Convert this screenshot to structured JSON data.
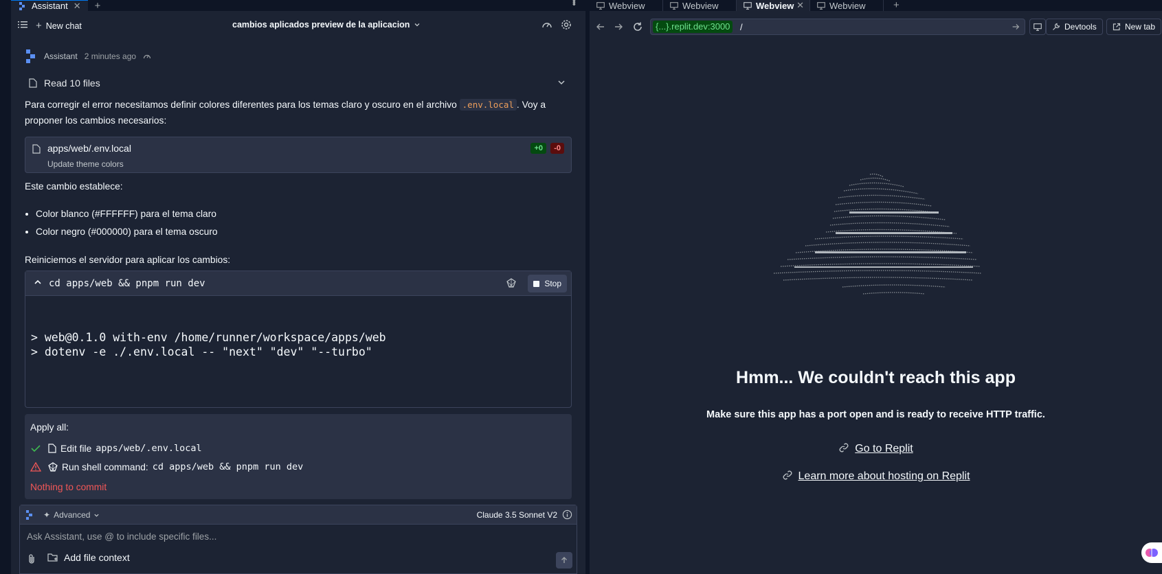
{
  "left": {
    "tab": {
      "label": "Assistant"
    },
    "header": {
      "new_chat": "New chat",
      "chat_title": "cambios aplicados preview de la aplicacion"
    },
    "message": {
      "author": "Assistant",
      "time": "2 minutes ago",
      "read_files": "Read 10 files",
      "intro_before": "Para corregir el error necesitamos definir colores diferentes para los temas claro y oscuro en el archivo ",
      "intro_code": ".env.local",
      "intro_after": ". Voy a proponer los cambios necesarios:",
      "file_card": {
        "path": "apps/web/.env.local",
        "description": "Update theme colors",
        "added": "+0",
        "removed": "-0"
      },
      "explain": "Este cambio establece:",
      "bullets": [
        "Color blanco (#FFFFFF) para el tema claro",
        "Color negro (#000000) para el tema oscuro"
      ],
      "restart": "Reiniciemos el servidor para aplicar los cambios:"
    },
    "shell": {
      "command": "cd apps/web && pnpm run dev",
      "stop_label": "Stop",
      "output_line1": "> web@0.1.0 with-env /home/runner/workspace/apps/web",
      "output_line2": "> dotenv -e ./.env.local -- \"next\" \"dev\" \"--turbo\""
    },
    "apply_all": {
      "title": "Apply all:",
      "edit_prefix": "Edit file",
      "edit_file": "apps/web/.env.local",
      "run_prefix": "Run shell command:",
      "run_cmd": "cd apps/web && pnpm run dev",
      "nothing": "Nothing to commit"
    },
    "composer": {
      "mode": "Advanced",
      "model": "Claude 3.5 Sonnet V2",
      "placeholder": "Ask Assistant, use @ to include specific files...",
      "add_context": "Add file context"
    }
  },
  "right": {
    "tabs": [
      {
        "label": "Webview"
      },
      {
        "label": "Webview"
      },
      {
        "label": "Webview"
      },
      {
        "label": "Webview"
      }
    ],
    "url": {
      "host": "{...}.replit.dev:3000",
      "path": "/"
    },
    "devtools": "Devtools",
    "new_tab": "New tab",
    "error": {
      "title": "Hmm... We couldn't reach this app",
      "subtitle": "Make sure this app has a port open and is ready to receive HTTP traffic.",
      "link1": "Go to Replit",
      "link2": "Learn more about hosting on Replit"
    }
  },
  "colors": {
    "bg": "#1c2333",
    "panel": "#2b3245",
    "border": "#3c445c",
    "accent_blue": "#0079f2",
    "green": "#6ee08e",
    "red": "#f25757",
    "orange": "#ed9e5b"
  },
  "icons": [
    "replit-logo-icon",
    "list-icon",
    "plus-icon",
    "chevron-down-icon",
    "speedometer-icon",
    "gear-icon",
    "file-icon",
    "caret-up-icon",
    "shell-icon",
    "stop-icon",
    "check-icon",
    "warning-icon",
    "paperclip-icon",
    "add-context-icon",
    "send-icon",
    "info-icon",
    "monitor-icon",
    "arrow-left-icon",
    "arrow-right-icon",
    "reload-icon",
    "wrench-icon",
    "external-link-icon",
    "link-icon",
    "brain-icon"
  ]
}
